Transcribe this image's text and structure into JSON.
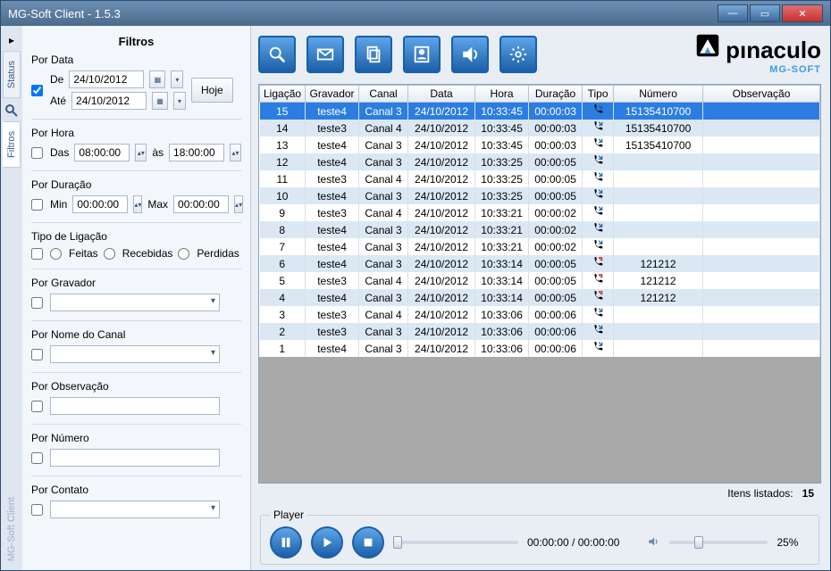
{
  "window": {
    "title": "MG-Soft Client - 1.5.3"
  },
  "vtabs": {
    "status": "Status",
    "filtros": "Filtros",
    "footer": "MG-Soft Client"
  },
  "filters": {
    "title": "Filtros",
    "porData": {
      "label": "Por Data",
      "de": "De",
      "ate": "Até",
      "deVal": "24/10/2012",
      "ateVal": "24/10/2012",
      "hoje": "Hoje",
      "checked": true
    },
    "porHora": {
      "label": "Por Hora",
      "das": "Das",
      "as": "às",
      "dasVal": "08:00:00",
      "ateVal": "18:00:00"
    },
    "porDuracao": {
      "label": "Por Duração",
      "min": "Min",
      "max": "Max",
      "minVal": "00:00:00",
      "maxVal": "00:00:00"
    },
    "tipoLigacao": {
      "label": "Tipo de Ligação",
      "feitas": "Feitas",
      "recebidas": "Recebidas",
      "perdidas": "Perdidas"
    },
    "porGravador": {
      "label": "Por Gravador"
    },
    "porNomeCanal": {
      "label": "Por Nome do Canal"
    },
    "porObservacao": {
      "label": "Por Observação"
    },
    "porNumero": {
      "label": "Por Número"
    },
    "porContato": {
      "label": "Por Contato"
    }
  },
  "logo": {
    "text": "pınaculo",
    "sub": "MG-SOFT"
  },
  "grid": {
    "headers": {
      "ligacao": "Ligação",
      "gravador": "Gravador",
      "canal": "Canal",
      "data": "Data",
      "hora": "Hora",
      "duracao": "Duração",
      "tipo": "Tipo",
      "numero": "Número",
      "observacao": "Observação"
    },
    "rows": [
      {
        "lig": "15",
        "grav": "teste4",
        "canal": "Canal 3",
        "data": "24/10/2012",
        "hora": "10:33:45",
        "dur": "00:00:03",
        "tipo": "in",
        "num": "15135410700",
        "obs": "",
        "sel": true
      },
      {
        "lig": "14",
        "grav": "teste3",
        "canal": "Canal 4",
        "data": "24/10/2012",
        "hora": "10:33:45",
        "dur": "00:00:03",
        "tipo": "in",
        "num": "15135410700",
        "obs": ""
      },
      {
        "lig": "13",
        "grav": "teste4",
        "canal": "Canal 3",
        "data": "24/10/2012",
        "hora": "10:33:45",
        "dur": "00:00:03",
        "tipo": "in",
        "num": "15135410700",
        "obs": ""
      },
      {
        "lig": "12",
        "grav": "teste4",
        "canal": "Canal 3",
        "data": "24/10/2012",
        "hora": "10:33:25",
        "dur": "00:00:05",
        "tipo": "in",
        "num": "",
        "obs": ""
      },
      {
        "lig": "11",
        "grav": "teste3",
        "canal": "Canal 4",
        "data": "24/10/2012",
        "hora": "10:33:25",
        "dur": "00:00:05",
        "tipo": "in",
        "num": "",
        "obs": ""
      },
      {
        "lig": "10",
        "grav": "teste4",
        "canal": "Canal 3",
        "data": "24/10/2012",
        "hora": "10:33:25",
        "dur": "00:00:05",
        "tipo": "in",
        "num": "",
        "obs": ""
      },
      {
        "lig": "9",
        "grav": "teste3",
        "canal": "Canal 4",
        "data": "24/10/2012",
        "hora": "10:33:21",
        "dur": "00:00:02",
        "tipo": "in",
        "num": "",
        "obs": ""
      },
      {
        "lig": "8",
        "grav": "teste4",
        "canal": "Canal 3",
        "data": "24/10/2012",
        "hora": "10:33:21",
        "dur": "00:00:02",
        "tipo": "in",
        "num": "",
        "obs": ""
      },
      {
        "lig": "7",
        "grav": "teste4",
        "canal": "Canal 3",
        "data": "24/10/2012",
        "hora": "10:33:21",
        "dur": "00:00:02",
        "tipo": "in",
        "num": "",
        "obs": ""
      },
      {
        "lig": "6",
        "grav": "teste4",
        "canal": "Canal 3",
        "data": "24/10/2012",
        "hora": "10:33:14",
        "dur": "00:00:05",
        "tipo": "out",
        "num": "121212",
        "obs": ""
      },
      {
        "lig": "5",
        "grav": "teste3",
        "canal": "Canal 4",
        "data": "24/10/2012",
        "hora": "10:33:14",
        "dur": "00:00:05",
        "tipo": "out",
        "num": "121212",
        "obs": ""
      },
      {
        "lig": "4",
        "grav": "teste4",
        "canal": "Canal 3",
        "data": "24/10/2012",
        "hora": "10:33:14",
        "dur": "00:00:05",
        "tipo": "out",
        "num": "121212",
        "obs": ""
      },
      {
        "lig": "3",
        "grav": "teste3",
        "canal": "Canal 4",
        "data": "24/10/2012",
        "hora": "10:33:06",
        "dur": "00:00:06",
        "tipo": "in",
        "num": "",
        "obs": ""
      },
      {
        "lig": "2",
        "grav": "teste3",
        "canal": "Canal 3",
        "data": "24/10/2012",
        "hora": "10:33:06",
        "dur": "00:00:06",
        "tipo": "in",
        "num": "",
        "obs": ""
      },
      {
        "lig": "1",
        "grav": "teste4",
        "canal": "Canal 3",
        "data": "24/10/2012",
        "hora": "10:33:06",
        "dur": "00:00:06",
        "tipo": "in",
        "num": "",
        "obs": ""
      }
    ]
  },
  "status": {
    "label": "Itens listados:",
    "count": "15"
  },
  "player": {
    "label": "Player",
    "time": "00:00:00 / 00:00:00",
    "vol": "25%"
  }
}
